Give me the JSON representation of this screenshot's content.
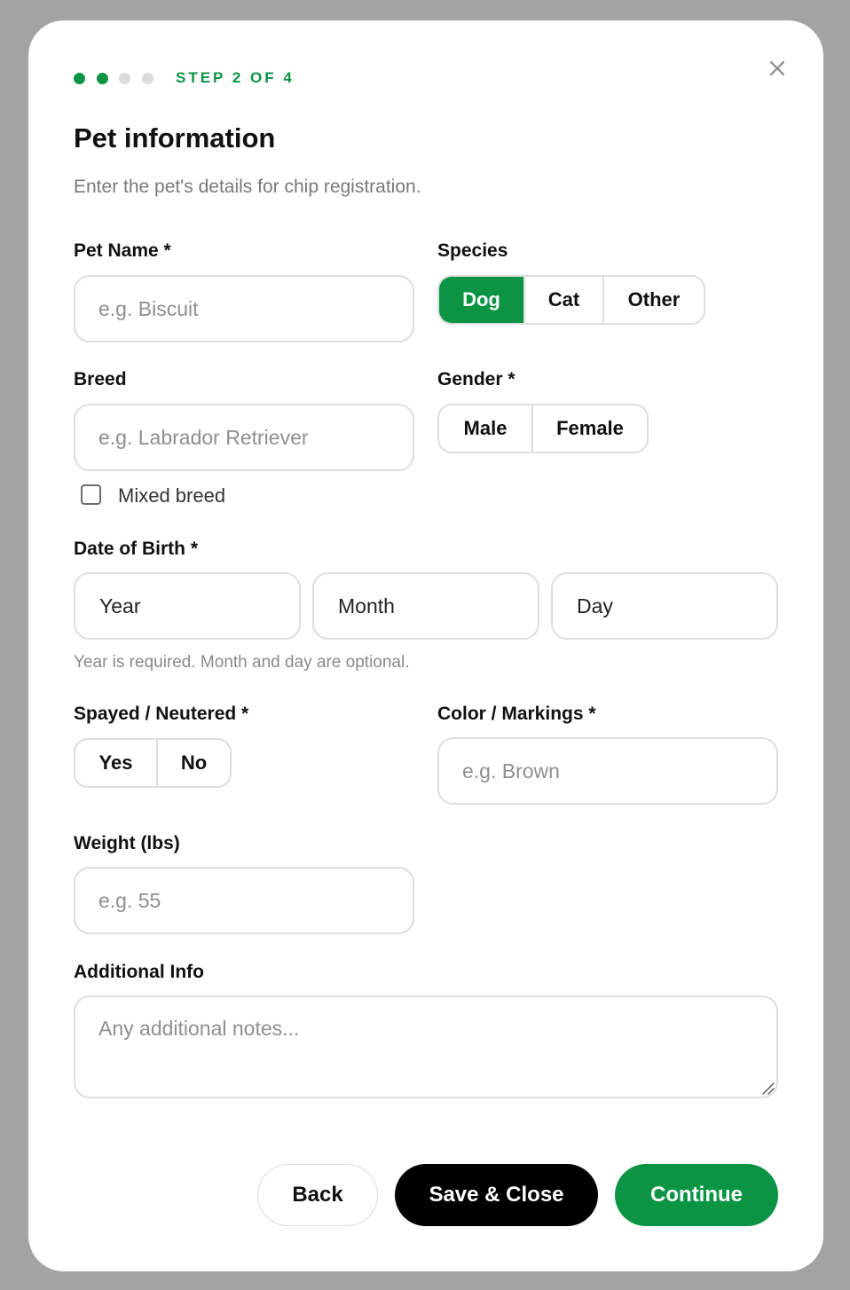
{
  "stepper": {
    "steps": [
      {
        "state": "complete"
      },
      {
        "state": "current"
      },
      {
        "state": "pending"
      },
      {
        "state": "pending"
      }
    ],
    "label": "STEP 2 OF 4",
    "accent_color": "#0b9444"
  },
  "close": {
    "icon": "close-icon"
  },
  "header": {
    "title": "Pet information",
    "subtitle": "Enter the pet's details for chip registration."
  },
  "form": {
    "pet_name": {
      "label": "Pet Name *",
      "placeholder": "e.g. Biscuit",
      "value": ""
    },
    "species": {
      "label": "Species",
      "options": [
        "Dog",
        "Cat",
        "Other"
      ],
      "selected": "Dog"
    },
    "breed": {
      "label": "Breed",
      "placeholder": "e.g. Labrador Retriever",
      "value": ""
    },
    "mixed_breed": {
      "label": "Mixed breed",
      "checked": false
    },
    "gender": {
      "label": "Gender *",
      "options": [
        "Male",
        "Female"
      ],
      "selected": null
    },
    "dob": {
      "label": "Date of Birth *",
      "year": "Year",
      "month": "Month",
      "day": "Day",
      "hint": "Year is required. Month and day are optional."
    },
    "spayed": {
      "label": "Spayed / Neutered *",
      "options": [
        "Yes",
        "No"
      ],
      "selected": null
    },
    "color": {
      "label": "Color / Markings *",
      "placeholder": "e.g. Brown",
      "value": ""
    },
    "weight": {
      "label": "Weight (lbs)",
      "placeholder": "e.g. 55",
      "value": ""
    },
    "additional": {
      "label": "Additional Info",
      "placeholder": "Any additional notes...",
      "value": ""
    }
  },
  "footer": {
    "back_label": "Back",
    "save_label": "Save & Close",
    "continue_label": "Continue"
  }
}
